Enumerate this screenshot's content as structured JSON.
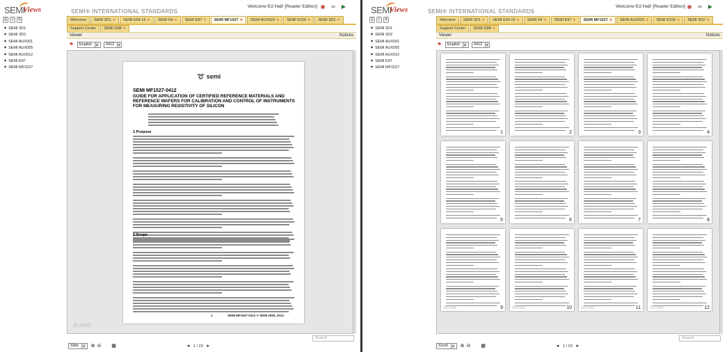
{
  "app": {
    "logo_semi": "SEMI",
    "logo_views": "Views",
    "brand": "SEMI® INTERNATIONAL STANDARDS",
    "welcome": "Welcome Ed Hall! [Reader Edition]"
  },
  "tabs": [
    "Welcome",
    "SEMI 3D1",
    "SEMI E54.15",
    "SEMI S4",
    "SEMI E97",
    "SEMI MF1527",
    "SEMI AUX023",
    "SEMI E156",
    "SEMI 3D2"
  ],
  "active_tab": "SEMI MF1527",
  "tabs2": [
    "Support Center",
    "SEMI G88"
  ],
  "viewer_label": "Viewer",
  "notices_label": "Notices",
  "sidebar": {
    "docs": [
      "SEMI 3D1",
      "SEMI 3D2",
      "SEMI AUX001",
      "SEMI AUX005",
      "SEMI AUX012",
      "SEMI E97",
      "SEMI MF1527"
    ]
  },
  "controls": {
    "language": "English",
    "version": "0412"
  },
  "left_viewer": {
    "logo": "semi",
    "doc_title": "SEMI MF1527-0412",
    "doc_heading": "GUIDE FOR APPLICATION OF CERTIFIED REFERENCE MATERIALS AND REFERENCE WAFERS FOR CALIBRATION AND CONTROL OF INSTRUMENTS FOR MEASURING RESISTIVITY OF SILICON",
    "section1": "1  Purpose",
    "section2": "2  Scope",
    "footer_page": "1",
    "footer_copyright": "SEMI MF1527-0412 © SEMI 2005, 2012",
    "watermark": "Scribd.",
    "mode": "Slide",
    "page_indicator": "1 / 23",
    "search_placeholder": "Search"
  },
  "right_viewer": {
    "thumb_numbers": [
      "1",
      "2",
      "3",
      "4",
      "5",
      "6",
      "7",
      "8",
      "9",
      "10",
      "11",
      "12"
    ],
    "watermark": "Scribd.",
    "mode": "Scroll",
    "page_indicator": "1 / 23",
    "search_placeholder": "Search"
  }
}
